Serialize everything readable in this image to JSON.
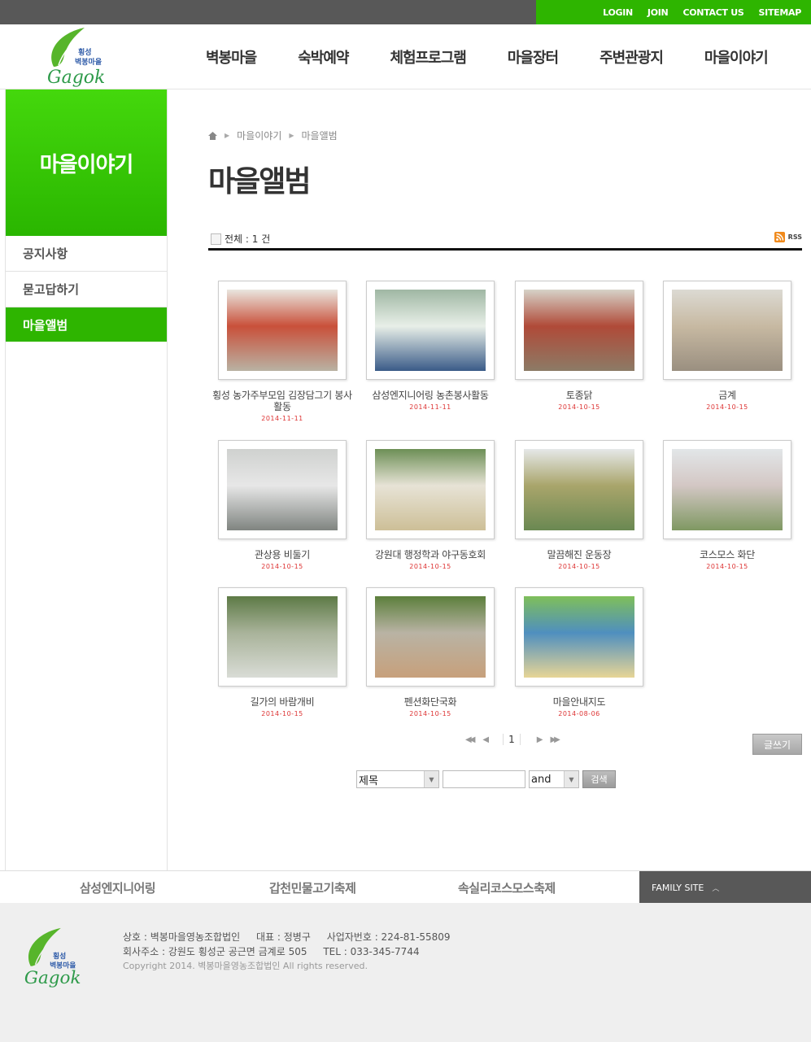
{
  "util_links": [
    "LOGIN",
    "JOIN",
    "CONTACT US",
    "SITEMAP"
  ],
  "logo": {
    "line1": "횡성",
    "line2": "벽봉마을",
    "script": "Gagok"
  },
  "gnb": [
    "벽봉마을",
    "숙박예약",
    "체험프로그램",
    "마을장터",
    "주변관광지",
    "마을이야기"
  ],
  "lnb": {
    "title": "마을이야기",
    "items": [
      "공지사항",
      "묻고답하기",
      "마을앨범"
    ]
  },
  "breadcrumb": [
    "마을이야기",
    "마을앨범"
  ],
  "page_title": "마을앨범",
  "board": {
    "total_label": "전체 : 1 건",
    "rss_label": "RSS"
  },
  "gallery": [
    {
      "caption": "횡성 농가주부모임 김장담그기 봉사활동",
      "date": "2014-11-11",
      "colors": [
        "#e9e6df",
        "#b9b2a3",
        "#c9503a"
      ]
    },
    {
      "caption": "삼성엔지니어링 농촌봉사활동",
      "date": "2014-11-11",
      "colors": [
        "#9fb7a3",
        "#3a5b88",
        "#e8efe8"
      ]
    },
    {
      "caption": "토종닭",
      "date": "2014-10-15",
      "colors": [
        "#d6d2c8",
        "#8c7b66",
        "#b04a38"
      ]
    },
    {
      "caption": "금계",
      "date": "2014-10-15",
      "colors": [
        "#dcdad3",
        "#9a8f80",
        "#c7b9a2"
      ]
    },
    {
      "caption": "관상용 비둘기",
      "date": "2014-10-15",
      "colors": [
        "#cfd1cf",
        "#7f8480",
        "#e7e7e7"
      ]
    },
    {
      "caption": "강원대 행정학과 야구동호회",
      "date": "2014-10-15",
      "colors": [
        "#6d8f56",
        "#cdbf97",
        "#e7e3d6"
      ]
    },
    {
      "caption": "말끔해진 운동장",
      "date": "2014-10-15",
      "colors": [
        "#e5e8e8",
        "#6a8852",
        "#a9a56b"
      ]
    },
    {
      "caption": "코스모스 화단",
      "date": "2014-10-15",
      "colors": [
        "#e2e6e8",
        "#7f9862",
        "#d3c7c4"
      ]
    },
    {
      "caption": "길가의 바람개비",
      "date": "2014-10-15",
      "colors": [
        "#5d7a46",
        "#d9dcd6",
        "#a9b39a"
      ]
    },
    {
      "caption": "펜션화단국화",
      "date": "2014-10-15",
      "colors": [
        "#5c7f3c",
        "#c7a07b",
        "#b9b3a4"
      ]
    },
    {
      "caption": "마을안내지도",
      "date": "2014-08-06",
      "colors": [
        "#7fbf5a",
        "#e7d596",
        "#4f8fbf"
      ]
    }
  ],
  "pager": {
    "current": "1"
  },
  "write_label": "글쓰기",
  "search": {
    "field": "제목",
    "op": "and",
    "button": "검색"
  },
  "family_links": [
    "삼성엔지니어링",
    "갑천민물고기축제",
    "속실리코스모스축제"
  ],
  "family_site": "FAMILY SITE",
  "footer": {
    "company": "상호 : 벽봉마을영농조합법인",
    "ceo": "대표 : 정병구",
    "bizno": "사업자번호 : 224-81-55809",
    "address": "회사주소 : 강원도 횡성군 공근면 금계로 505",
    "tel": "TEL : 033-345-7744",
    "copyright": "Copyright 2014. 벽봉마을영농조합법인 All rights reserved."
  }
}
